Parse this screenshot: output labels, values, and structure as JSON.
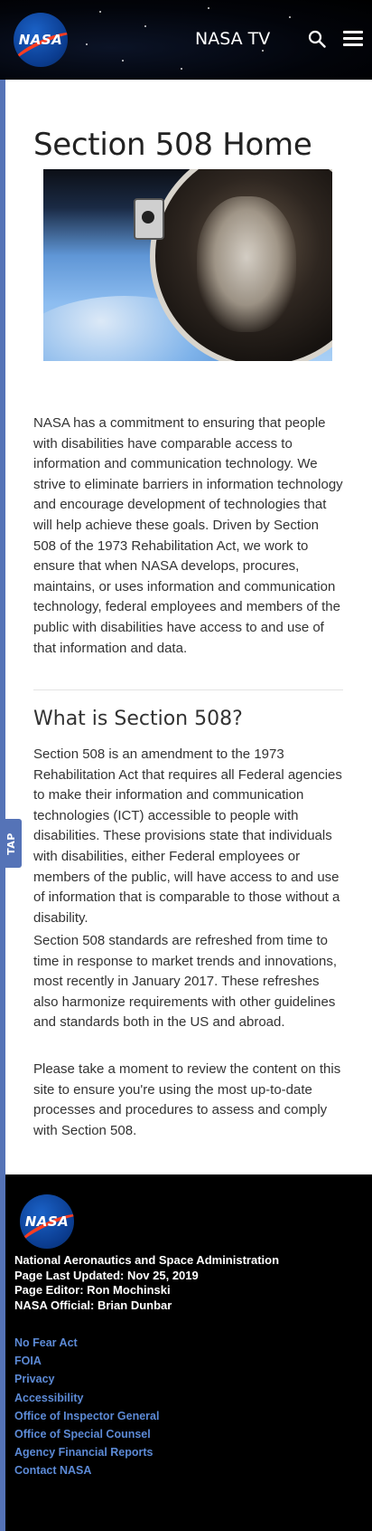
{
  "header": {
    "logo_text": "NASA",
    "nasa_tv": "NASA TV"
  },
  "main": {
    "title": "Section 508 Home",
    "intro": "NASA has a commitment to ensuring that people with disabilities have comparable access to information and communication technology. We strive to eliminate barriers in information technology and encourage development of technologies that will help achieve these goals. Driven by Section 508 of the 1973 Rehabilitation Act, we work to ensure that when NASA develops, procures, maintains, or uses information and communication technology, federal employees and members of the public with disabilities have access to and use of that information and data.",
    "section_title": "What is Section 508?",
    "paragraphs": [
      "Section 508 is an amendment to the 1973 Rehabilitation Act that requires all Federal agencies to make their information and communication technologies (ICT) accessible to people with disabilities. These provisions state that individuals with disabilities, either Federal employees or members of the public, will have access to and use of information that is comparable to those without a disability.",
      "Section 508 standards are refreshed from time to time in response to market trends and innovations, most recently in January 2017. These refreshes also harmonize requirements with other guidelines and standards both in the US and abroad.",
      "Please take a moment to review the content on this site to ensure you're using the most up-to-date processes and procedures to assess and comply with Section 508."
    ],
    "tap_label": "TAP"
  },
  "footer": {
    "logo_text": "NASA",
    "agency": "National Aeronautics and Space Administration",
    "updated": "Page Last Updated: Nov 25, 2019",
    "editor": "Page Editor: Ron Mochinski",
    "official": "NASA Official: Brian Dunbar",
    "links": [
      "No Fear Act",
      "FOIA",
      "Privacy",
      "Accessibility",
      "Office of Inspector General",
      "Office of Special Counsel",
      "Agency Financial Reports",
      "Contact NASA"
    ]
  },
  "colors": {
    "accent_bar": "#5573b7",
    "link": "#5c8ad6",
    "nasa_blue": "#0b3d91",
    "nasa_red": "#fc3d21"
  },
  "icons": [
    "search-icon",
    "menu-icon"
  ]
}
